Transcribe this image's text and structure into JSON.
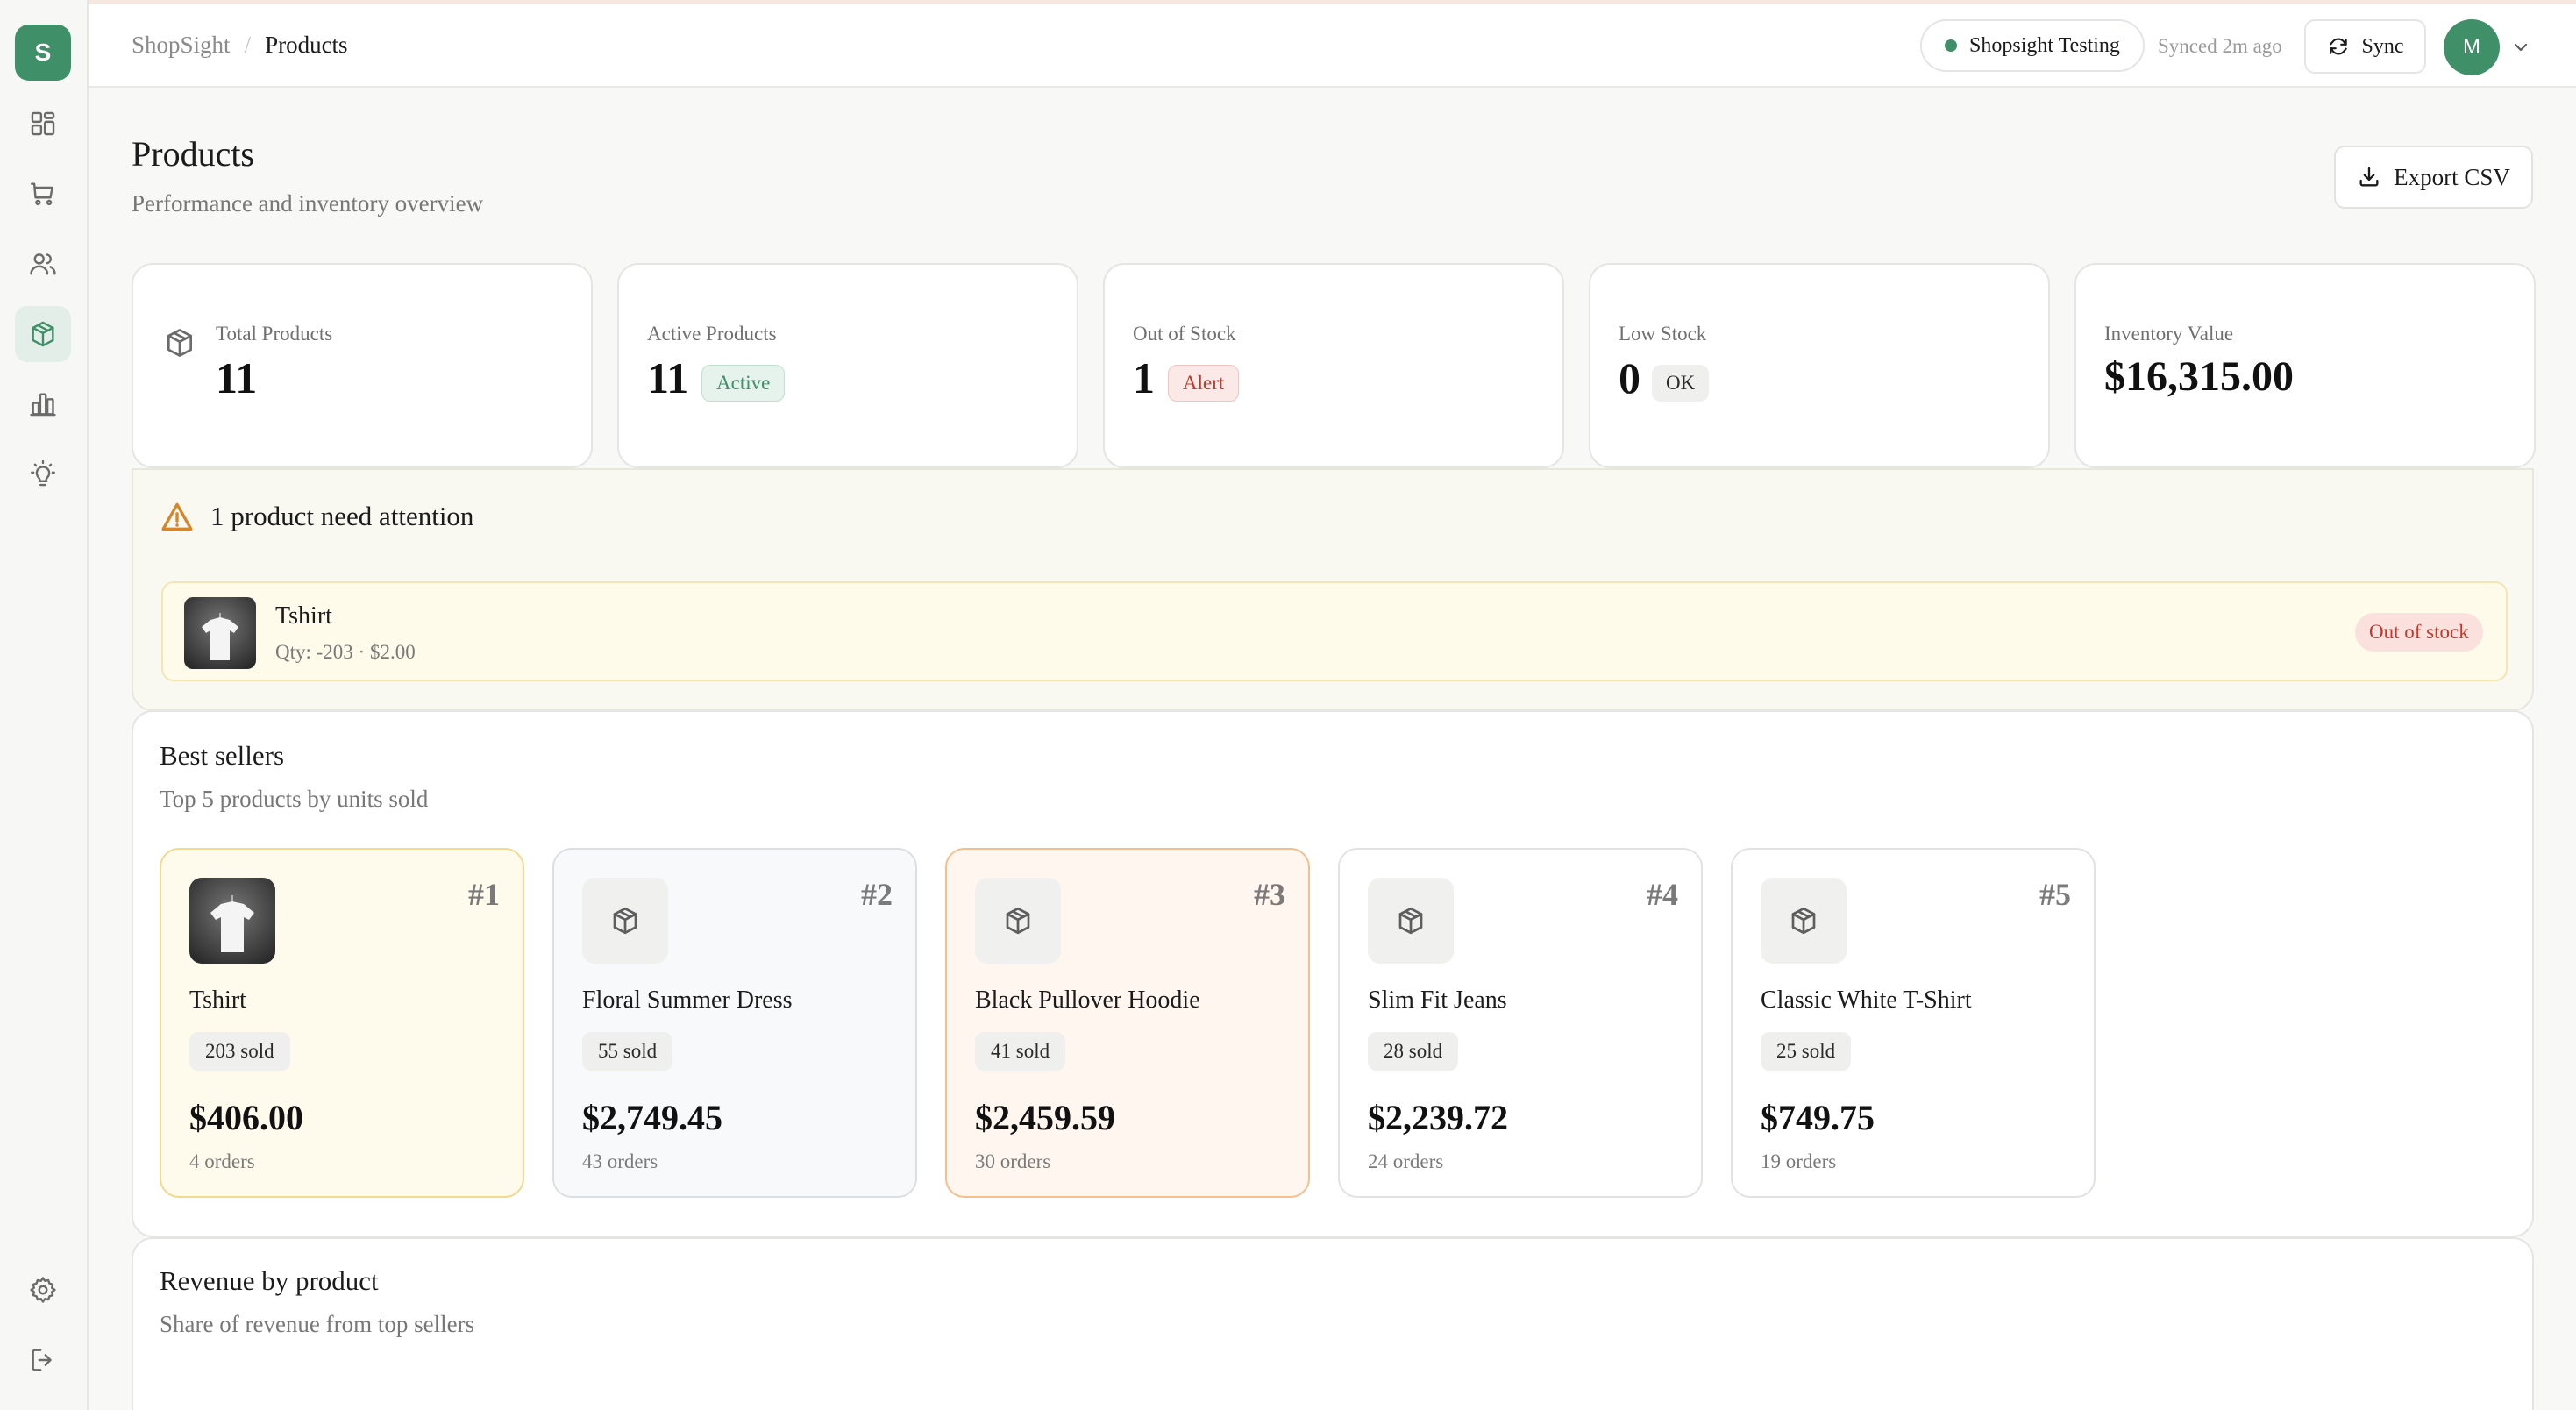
{
  "app": {
    "logo_letter": "S"
  },
  "colors": {
    "brand": "#3f8f68",
    "alert": "#c0392b",
    "warning": "#d4862a"
  },
  "sidebar": {
    "items": [
      {
        "name": "dashboard",
        "icon": "grid-icon",
        "active": false
      },
      {
        "name": "orders",
        "icon": "cart-icon",
        "active": false
      },
      {
        "name": "customers",
        "icon": "users-icon",
        "active": false
      },
      {
        "name": "products",
        "icon": "box-icon",
        "active": true
      },
      {
        "name": "analytics",
        "icon": "bar-chart-icon",
        "active": false
      },
      {
        "name": "insights",
        "icon": "lightbulb-icon",
        "active": false
      }
    ],
    "bottom_items": [
      {
        "name": "settings",
        "icon": "gear-icon"
      },
      {
        "name": "logout",
        "icon": "logout-icon"
      }
    ]
  },
  "header": {
    "breadcrumb_root": "ShopSight",
    "breadcrumb_sep": "/",
    "breadcrumb_current": "Products",
    "store_name": "Shopsight Testing",
    "synced_text": "Synced 2m ago",
    "sync_label": "Sync",
    "avatar_initial": "M"
  },
  "page": {
    "title": "Products",
    "subtitle": "Performance and inventory overview",
    "export_label": "Export CSV"
  },
  "stats": {
    "total": {
      "label": "Total Products",
      "value": "11"
    },
    "active": {
      "label": "Active Products",
      "value": "11",
      "badge": "Active"
    },
    "out_of_stock": {
      "label": "Out of Stock",
      "value": "1",
      "badge": "Alert"
    },
    "low_stock": {
      "label": "Low Stock",
      "value": "0",
      "badge": "OK"
    },
    "inventory": {
      "label": "Inventory Value",
      "value": "$16,315.00"
    }
  },
  "attention": {
    "title": "1 product need attention",
    "items": [
      {
        "name": "Tshirt",
        "meta": "Qty: -203 · $2.00",
        "badge": "Out of stock"
      }
    ]
  },
  "best_sellers": {
    "title": "Best sellers",
    "subtitle": "Top 5 products by units sold",
    "items": [
      {
        "rank": "#1",
        "name": "Tshirt",
        "sold": "203 sold",
        "revenue": "$406.00",
        "orders": "4 orders"
      },
      {
        "rank": "#2",
        "name": "Floral Summer Dress",
        "sold": "55 sold",
        "revenue": "$2,749.45",
        "orders": "43 orders"
      },
      {
        "rank": "#3",
        "name": "Black Pullover Hoodie",
        "sold": "41 sold",
        "revenue": "$2,459.59",
        "orders": "30 orders"
      },
      {
        "rank": "#4",
        "name": "Slim Fit Jeans",
        "sold": "28 sold",
        "revenue": "$2,239.72",
        "orders": "24 orders"
      },
      {
        "rank": "#5",
        "name": "Classic White T-Shirt",
        "sold": "25 sold",
        "revenue": "$749.75",
        "orders": "19 orders"
      }
    ]
  },
  "revenue_by_product": {
    "title": "Revenue by product",
    "subtitle": "Share of revenue from top sellers"
  }
}
